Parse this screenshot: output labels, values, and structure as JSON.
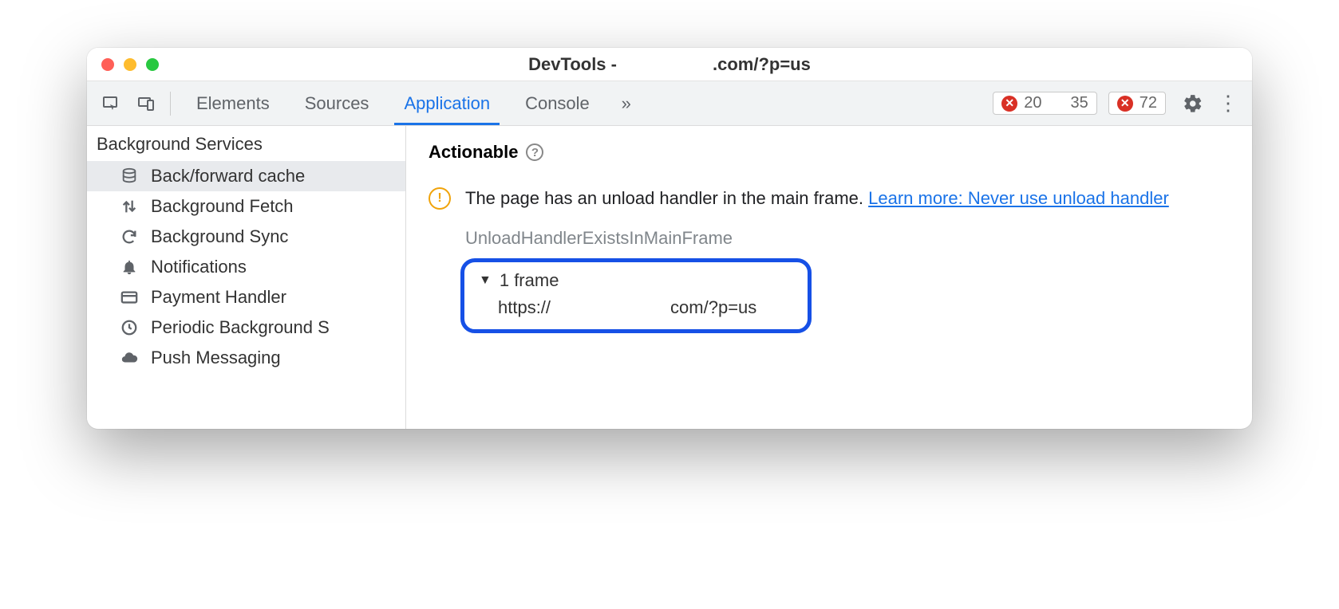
{
  "window": {
    "title_prefix": "DevTools -",
    "title_suffix": ".com/?p=us"
  },
  "toolbar": {
    "tabs": [
      "Elements",
      "Sources",
      "Application",
      "Console"
    ],
    "active_tab": "Application",
    "errors": "20",
    "warnings": "35",
    "issues": "72"
  },
  "sidebar": {
    "header": "Background Services",
    "items": [
      {
        "label": "Back/forward cache",
        "icon": "database-icon",
        "selected": true
      },
      {
        "label": "Background Fetch",
        "icon": "updown-arrows-icon",
        "selected": false
      },
      {
        "label": "Background Sync",
        "icon": "sync-icon",
        "selected": false
      },
      {
        "label": "Notifications",
        "icon": "bell-icon",
        "selected": false
      },
      {
        "label": "Payment Handler",
        "icon": "card-icon",
        "selected": false
      },
      {
        "label": "Periodic Background S",
        "icon": "clock-icon",
        "selected": false
      },
      {
        "label": "Push Messaging",
        "icon": "cloud-icon",
        "selected": false
      }
    ]
  },
  "content": {
    "section_title": "Actionable",
    "issue_text": "The page has an unload handler in the main frame. ",
    "learn_more": "Learn more: Never use unload handler",
    "reason": "UnloadHandlerExistsInMainFrame",
    "frame_count": "1 frame",
    "frame_url_prefix": "https://",
    "frame_url_suffix": "com/?p=us"
  }
}
